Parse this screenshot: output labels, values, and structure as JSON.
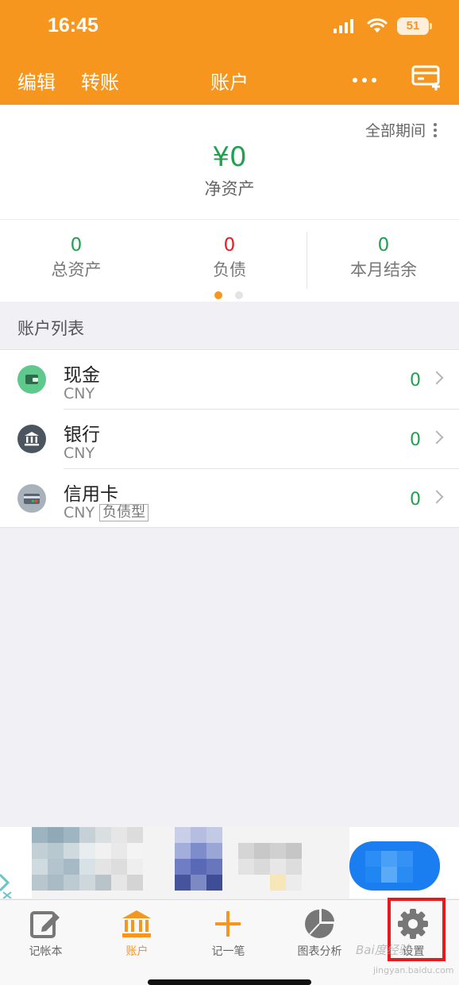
{
  "status_bar": {
    "time": "16:45",
    "battery": "51"
  },
  "header": {
    "edit_label": "编辑",
    "transfer_label": "转账",
    "title": "账户",
    "more_icon": "more-icon",
    "add_card_icon": "add-card-icon"
  },
  "summary": {
    "period_label": "全部期间",
    "net_value": "¥0",
    "net_label": "净资产",
    "stats": [
      {
        "value": "0",
        "label": "总资产",
        "color": "#22a050"
      },
      {
        "value": "0",
        "label": "负债",
        "color": "#e02020"
      },
      {
        "value": "0",
        "label": "本月结余",
        "color": "#22a050"
      }
    ],
    "page_dot_active": "#f7961f",
    "page_dot_inactive": "#e4e4e4"
  },
  "accounts": {
    "header": "账户列表",
    "items": [
      {
        "name": "现金",
        "currency": "CNY",
        "tag": "",
        "amount": "0",
        "icon": "wallet-icon",
        "icon_color": "#5ec98d"
      },
      {
        "name": "银行",
        "currency": "CNY",
        "tag": "",
        "amount": "0",
        "icon": "bank-icon",
        "icon_color": "#4a5560"
      },
      {
        "name": "信用卡",
        "currency": "CNY",
        "tag": "负债型",
        "amount": "0",
        "icon": "credit-card-icon",
        "icon_color": "#a9b1bb"
      }
    ]
  },
  "tabbar": {
    "tabs": [
      {
        "label": "记帐本",
        "icon": "notebook-icon",
        "active": false
      },
      {
        "label": "账户",
        "icon": "bank-icon",
        "active": true
      },
      {
        "label": "记一笔",
        "icon": "plus-icon",
        "active": false
      },
      {
        "label": "图表分析",
        "icon": "pie-chart-icon",
        "active": false
      },
      {
        "label": "设置",
        "icon": "gear-icon",
        "active": false
      }
    ]
  },
  "watermark": {
    "brand": "Bai度经验",
    "url": "jingyan.baidu.com"
  },
  "colors": {
    "brand_orange": "#f7961f",
    "positive": "#22a050",
    "negative": "#e02020",
    "highlight_box": "#e8191c"
  }
}
